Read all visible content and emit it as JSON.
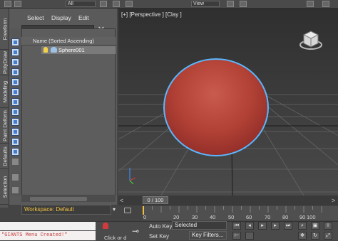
{
  "toolbar": {
    "selection_filter": "All",
    "view_dropdown": "View"
  },
  "ribbon": {
    "tabs": [
      "Freeform",
      "PolyDraw",
      "Modeling",
      "Paint Deform",
      "Defaults",
      "Selection"
    ]
  },
  "scene_explorer": {
    "menu": [
      "Select",
      "Display",
      "Edit"
    ],
    "clear_icon": "close-icon",
    "column_header": "Name (Sorted Ascending)",
    "objects": [
      {
        "name": "Sphere001",
        "icons": [
          "light-bulb-icon",
          "teapot-icon"
        ]
      }
    ]
  },
  "workspace": {
    "label": "Workspace: Default"
  },
  "viewport": {
    "label": "[+] [Perspective ] [Clay ]",
    "object": "sphere",
    "object_color": "#b34236",
    "selection_color": "#5ab7ff"
  },
  "timeline": {
    "slider_label": "0 / 100",
    "ticks": [
      "0",
      "20",
      "30",
      "40",
      "50",
      "60",
      "70",
      "80",
      "90",
      "100"
    ]
  },
  "status": {
    "listener_message": "\"GIANTS Menu Created!\"",
    "click_hint": "Click or d",
    "auto_key": "Auto Key",
    "set_key": "Set Key",
    "selected": "Selected",
    "key_filters": "Key Filters..."
  }
}
